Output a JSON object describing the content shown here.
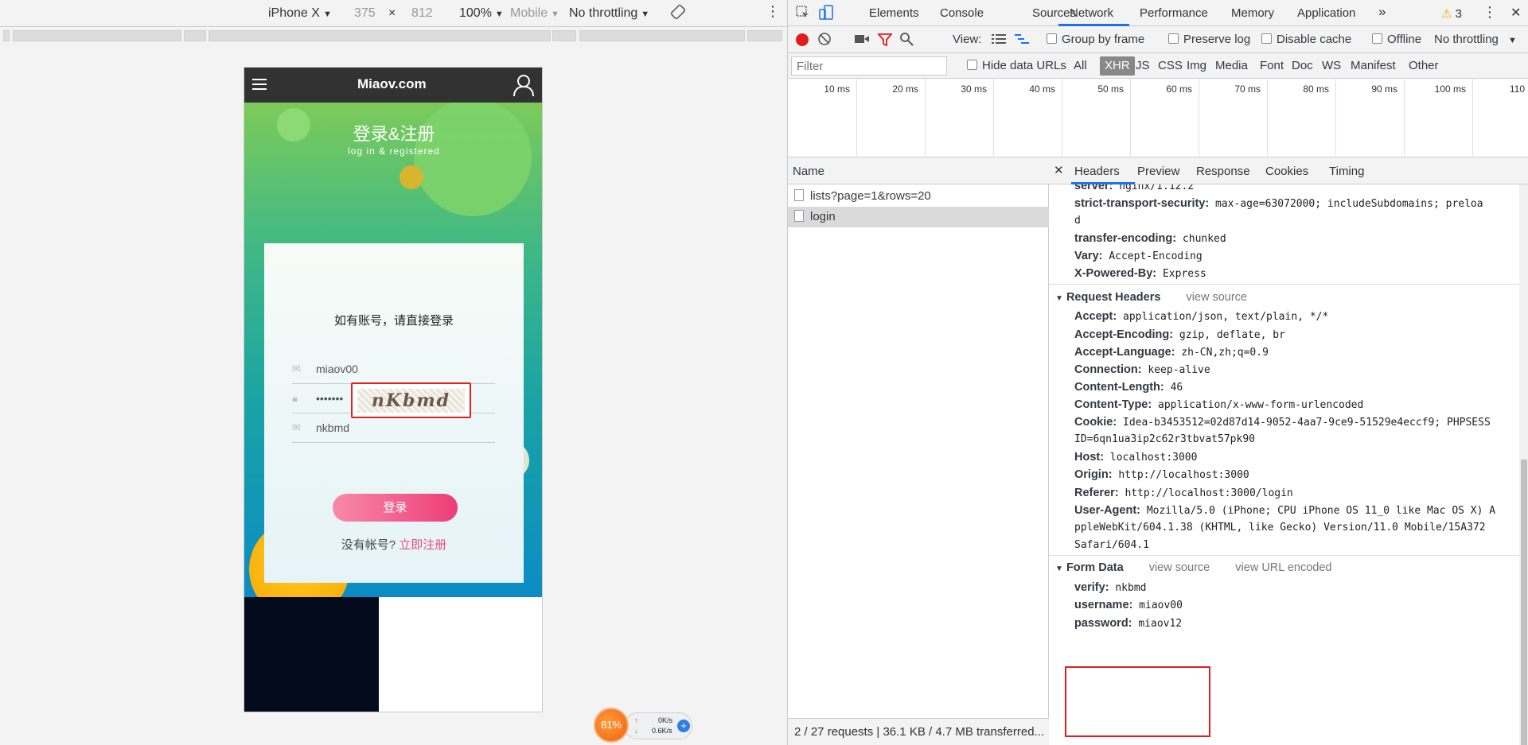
{
  "device_toolbar": {
    "device": "iPhone X",
    "width": "375",
    "times": "×",
    "height": "812",
    "zoom": "100%",
    "mode": "Mobile",
    "throttle": "No throttling"
  },
  "site": {
    "logo": "Miaov.com",
    "hero_title": "登录&注册",
    "hero_subtitle": "log in & registered",
    "card_title": "如有账号，请直接登录",
    "username_value": "miaov00",
    "password_value": "•••••••",
    "verify_value": "nkbmd",
    "captcha_text": "nKbmd",
    "login_button": "登录",
    "no_account": "没有帐号?",
    "register_link": "立即注册"
  },
  "speed_widget": {
    "percent": "81%",
    "up": "0K/s",
    "down": "0.6K/s"
  },
  "devtools": {
    "tabs": [
      "Elements",
      "Console",
      "Sources",
      "Network",
      "Performance",
      "Memory",
      "Application"
    ],
    "more": "»",
    "warnings": "3",
    "toolbar": {
      "view": "View:",
      "group_by_frame": "Group by frame",
      "preserve_log": "Preserve log",
      "disable_cache": "Disable cache",
      "offline": "Offline",
      "throttle": "No throttling"
    },
    "filter": {
      "placeholder": "Filter",
      "hide_data_urls": "Hide data URLs",
      "types": [
        "All",
        "XHR",
        "JS",
        "CSS",
        "Img",
        "Media",
        "Font",
        "Doc",
        "WS",
        "Manifest",
        "Other"
      ]
    },
    "timeline_ticks": [
      "10 ms",
      "20 ms",
      "30 ms",
      "40 ms",
      "50 ms",
      "60 ms",
      "70 ms",
      "80 ms",
      "90 ms",
      "100 ms",
      "110"
    ],
    "requests": {
      "header": "Name",
      "rows": [
        "lists?page=1&rows=20",
        "login"
      ],
      "status": "2 / 27 requests  |  36.1 KB / 4.7 MB transferred..."
    },
    "detail_tabs": [
      "Headers",
      "Preview",
      "Response",
      "Cookies",
      "Timing"
    ],
    "response_headers": [
      {
        "k": "server:",
        "v": "nginx/1.12.2"
      },
      {
        "k": "strict-transport-security:",
        "v": "max-age=63072000; includeSubdomains; preloa"
      },
      {
        "k": "",
        "v": "d"
      },
      {
        "k": "transfer-encoding:",
        "v": "chunked"
      },
      {
        "k": "Vary:",
        "v": "Accept-Encoding"
      },
      {
        "k": "X-Powered-By:",
        "v": "Express"
      }
    ],
    "request_headers_title": "Request Headers",
    "view_source": "view source",
    "request_headers": [
      {
        "k": "Accept:",
        "v": "application/json, text/plain, */*"
      },
      {
        "k": "Accept-Encoding:",
        "v": "gzip, deflate, br"
      },
      {
        "k": "Accept-Language:",
        "v": "zh-CN,zh;q=0.9"
      },
      {
        "k": "Connection:",
        "v": "keep-alive"
      },
      {
        "k": "Content-Length:",
        "v": "46"
      },
      {
        "k": "Content-Type:",
        "v": "application/x-www-form-urlencoded"
      },
      {
        "k": "Cookie:",
        "v": "Idea-b3453512=02d87d14-9052-4aa7-9ce9-51529e4eccf9; PHPSESS"
      },
      {
        "k": "",
        "v": "ID=6qn1ua3ip2c62r3tbvat57pk90"
      },
      {
        "k": "Host:",
        "v": "localhost:3000"
      },
      {
        "k": "Origin:",
        "v": "http://localhost:3000"
      },
      {
        "k": "Referer:",
        "v": "http://localhost:3000/login"
      },
      {
        "k": "User-Agent:",
        "v": "Mozilla/5.0 (iPhone; CPU iPhone OS 11_0 like Mac OS X) A"
      },
      {
        "k": "",
        "v": "ppleWebKit/604.1.38 (KHTML, like Gecko) Version/11.0 Mobile/15A372"
      },
      {
        "k": "",
        "v": "Safari/604.1"
      }
    ],
    "form_data_title": "Form Data",
    "view_url_encoded": "view URL encoded",
    "form_data": [
      {
        "k": "verify:",
        "v": "nkbmd"
      },
      {
        "k": "username:",
        "v": "miaov00"
      },
      {
        "k": "password:",
        "v": "miaov12"
      }
    ]
  }
}
